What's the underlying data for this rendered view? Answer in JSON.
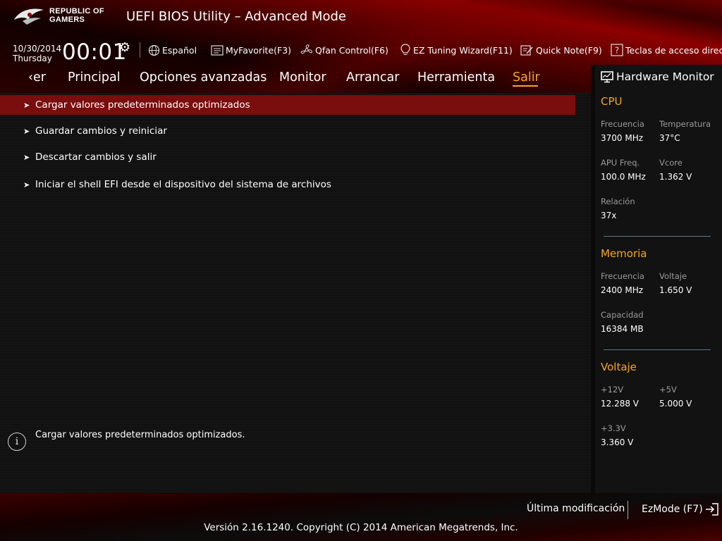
{
  "brand": {
    "logo_line1": "REPUBLIC OF",
    "logo_line2": "GAMERS",
    "title": "UEFI BIOS Utility – Advanced Mode"
  },
  "clock": {
    "date": "10/30/2014",
    "day": "Thursday",
    "time": "00:01"
  },
  "toolbar": {
    "language": "Español",
    "myfavorite": "MyFavorite(F3)",
    "qfan": "Qfan Control(F6)",
    "ez_tuning": "EZ Tuning Wizard(F11)",
    "quick_note": "Quick Note(F9)",
    "hotkeys": "Teclas de acceso directo"
  },
  "tabs": [
    "‹er",
    "Principal",
    "Opciones avanzadas",
    "Monitor",
    "Arrancar",
    "Herramienta",
    "Salir"
  ],
  "active_tab": "Salir",
  "menu": {
    "items": [
      "Cargar valores predeterminados optimizados",
      "Guardar cambios y reiniciar",
      "Descartar cambios y salir",
      "Iniciar el shell EFI desde el dispositivo del sistema de archivos"
    ],
    "selected_index": 0
  },
  "help_text": "Cargar valores predeterminados optimizados.",
  "hardware_monitor": {
    "title": "Hardware Monitor",
    "cpu": {
      "heading": "CPU",
      "freq_label": "Frecuencia",
      "freq_value": "3700 MHz",
      "temp_label": "Temperatura",
      "temp_value": "37°C",
      "apu_label": "APU Freq.",
      "apu_value": "100.0 MHz",
      "vcore_label": "Vcore",
      "vcore_value": "1.362 V",
      "ratio_label": "Relación",
      "ratio_value": "37x"
    },
    "memory": {
      "heading": "Memoria",
      "freq_label": "Frecuencia",
      "freq_value": "2400 MHz",
      "volt_label": "Voltaje",
      "volt_value": "1.650 V",
      "cap_label": "Capacidad",
      "cap_value": "16384 MB"
    },
    "voltage": {
      "heading": "Voltaje",
      "v12_label": "+12V",
      "v12_value": "12.288 V",
      "v5_label": "+5V",
      "v5_value": "5.000 V",
      "v33_label": "+3.3V",
      "v33_value": "3.360 V"
    }
  },
  "footer": {
    "last_modified": "Última modificación",
    "ezmode": "EzMode (F7)",
    "copyright": "Versión 2.16.1240. Copyright (C) 2014 American Megatrends, Inc."
  },
  "colors": {
    "accent": "#f5a623",
    "selection": "#7a0d0d",
    "brand_red": "#8e0000"
  }
}
